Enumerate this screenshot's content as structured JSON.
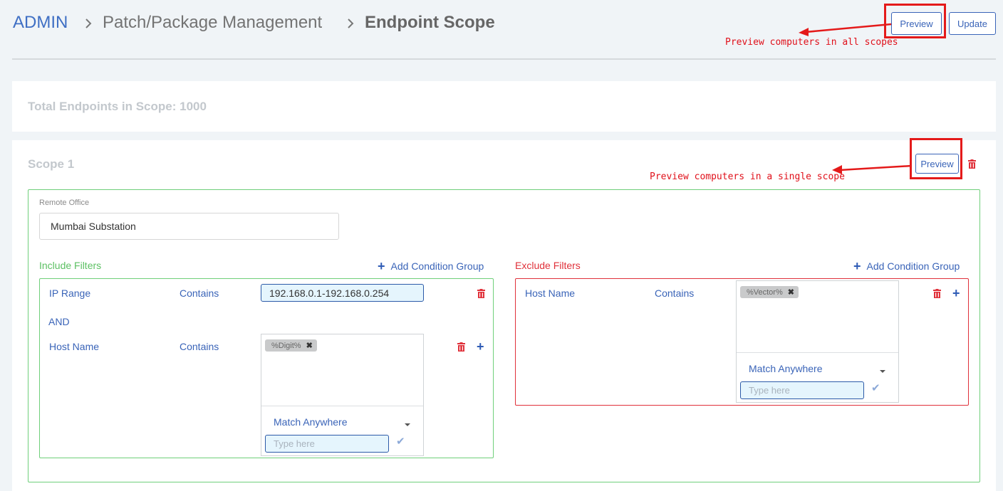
{
  "breadcrumb": {
    "root": "ADMIN",
    "parent": "Patch/Package Management",
    "current": "Endpoint Scope",
    "separator": ">"
  },
  "header": {
    "preview_label": "Preview",
    "update_label": "Update"
  },
  "annotations": {
    "all_scopes": "Preview computers in all scopes",
    "single_scope": "Preview computers in a single scope",
    "color": "#e41a1a"
  },
  "summary": {
    "total_label": "Total Endpoints in Scope: 1000"
  },
  "scope": {
    "title": "Scope 1",
    "preview_label": "Preview",
    "remote_office_label": "Remote Office",
    "remote_office_value": "Mumbai Substation",
    "include": {
      "title": "Include Filters",
      "add_group_label": "Add Condition Group",
      "row1": {
        "field": "IP Range",
        "operator": "Contains",
        "value": "192.168.0.1-192.168.0.254"
      },
      "join": "AND",
      "row2": {
        "field": "Host Name",
        "operator": "Contains",
        "tag": "%Digit%",
        "match_mode": "Match Anywhere",
        "placeholder": "Type here"
      }
    },
    "exclude": {
      "title": "Exclude Filters",
      "add_group_label": "Add Condition Group",
      "row1": {
        "field": "Host Name",
        "operator": "Contains",
        "tag": "%Vector%",
        "match_mode": "Match Anywhere",
        "placeholder": "Type here"
      }
    }
  },
  "colors": {
    "accent_blue": "#3a64b8",
    "include_green": "#5cc063",
    "exclude_red": "#e0313a",
    "trash_red": "#e0313a"
  }
}
